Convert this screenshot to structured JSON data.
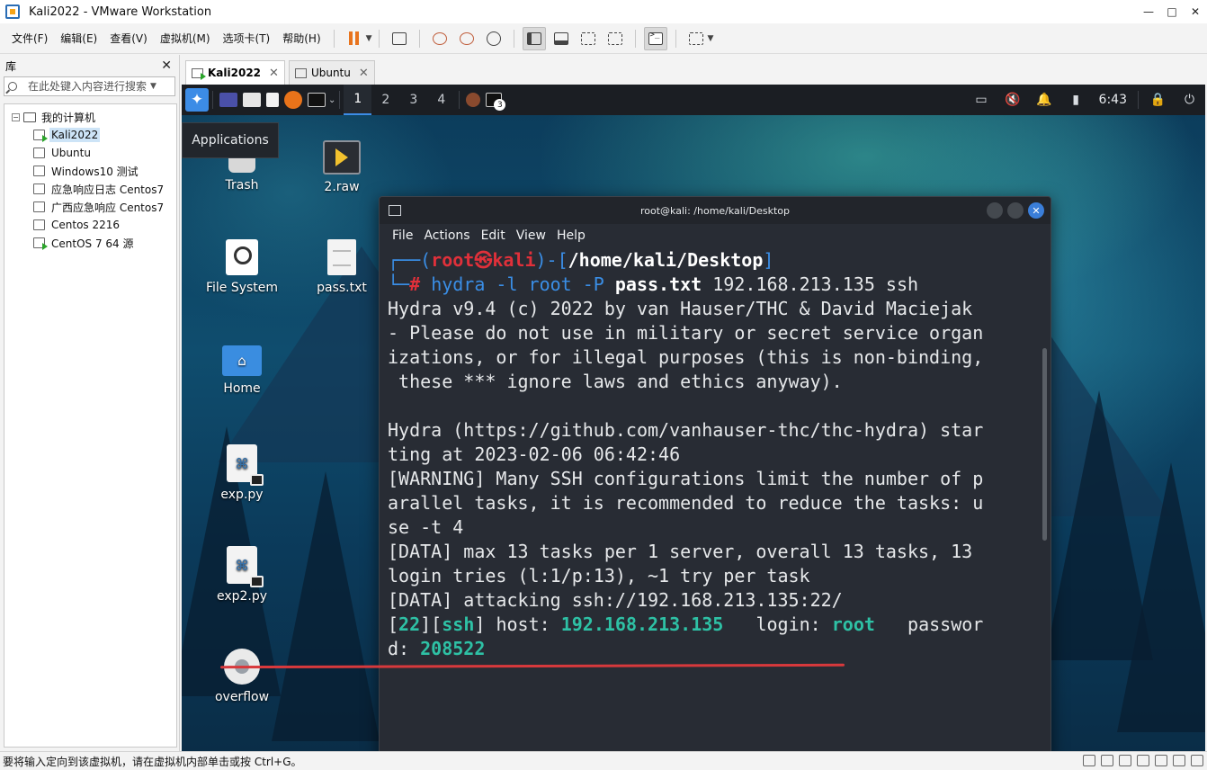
{
  "window": {
    "title": "Kali2022 - VMware Workstation"
  },
  "menu": [
    {
      "label": "文件(F)"
    },
    {
      "label": "编辑(E)"
    },
    {
      "label": "查看(V)"
    },
    {
      "label": "虚拟机(M)"
    },
    {
      "label": "选项卡(T)"
    },
    {
      "label": "帮助(H)"
    }
  ],
  "library": {
    "title": "库",
    "search_placeholder": "在此处键入内容进行搜索",
    "root": "我的计算机",
    "vms": [
      {
        "name": "Kali2022",
        "running": true,
        "selected": true
      },
      {
        "name": "Ubuntu",
        "running": false,
        "selected": false
      },
      {
        "name": "Windows10 测试",
        "running": false,
        "selected": false
      },
      {
        "name": "应急响应日志 Centos7",
        "running": false,
        "selected": false
      },
      {
        "name": "广西应急响应 Centos7",
        "running": false,
        "selected": false
      },
      {
        "name": "Centos 2216",
        "running": false,
        "selected": false
      },
      {
        "name": "CentOS 7 64 源",
        "running": true,
        "selected": false
      }
    ]
  },
  "tabs": [
    {
      "label": "Kali2022",
      "active": true
    },
    {
      "label": "Ubuntu",
      "active": false
    }
  ],
  "kali_panel": {
    "workspaces": [
      "1",
      "2",
      "3",
      "4"
    ],
    "active_workspace": "1",
    "terminal_badge": "3",
    "clock": "6:43"
  },
  "tooltip": "Applications",
  "desktop_icons": [
    {
      "label": "Trash"
    },
    {
      "label": "2.raw"
    },
    {
      "label": "File System"
    },
    {
      "label": "pass.txt"
    },
    {
      "label": "Home"
    },
    {
      "label": "exp.py"
    },
    {
      "label": "exp2.py"
    },
    {
      "label": "overflow"
    }
  ],
  "terminal": {
    "title": "root@kali: /home/kali/Desktop",
    "menu": [
      "File",
      "Actions",
      "Edit",
      "View",
      "Help"
    ],
    "prompt_user": "root",
    "prompt_symbol": "㉿",
    "prompt_host": "kali",
    "prompt_cwd": "/home/kali/Desktop",
    "command_prefix": "hydra -l root -P ",
    "command_file": "pass.txt",
    "command_suffix": " 192.168.213.135 ssh",
    "output": [
      "Hydra v9.4 (c) 2022 by van Hauser/THC & David Maciejak",
      "- Please do not use in military or secret service organ",
      "izations, or for illegal purposes (this is non-binding,",
      " these *** ignore laws and ethics anyway).",
      "",
      "Hydra (https://github.com/vanhauser-thc/thc-hydra) star",
      "ting at 2023-02-06 06:42:46",
      "[WARNING] Many SSH configurations limit the number of p",
      "arallel tasks, it is recommended to reduce the tasks: u",
      "se -t 4",
      "[DATA] max 13 tasks per 1 server, overall 13 tasks, 13",
      "login tries (l:1/p:13), ~1 try per task",
      "[DATA] attacking ssh://192.168.213.135:22/"
    ],
    "result": {
      "port": "22",
      "service": "ssh",
      "host_label": " host: ",
      "host": "192.168.213.135",
      "login_label": "   login: ",
      "login": "root",
      "password_label_1": "   passwor",
      "password_label_2": "d: ",
      "password": "208522"
    }
  },
  "statusbar": {
    "text": "要将输入定向到该虚拟机，请在虚拟机内部单击或按 Ctrl+G。"
  }
}
